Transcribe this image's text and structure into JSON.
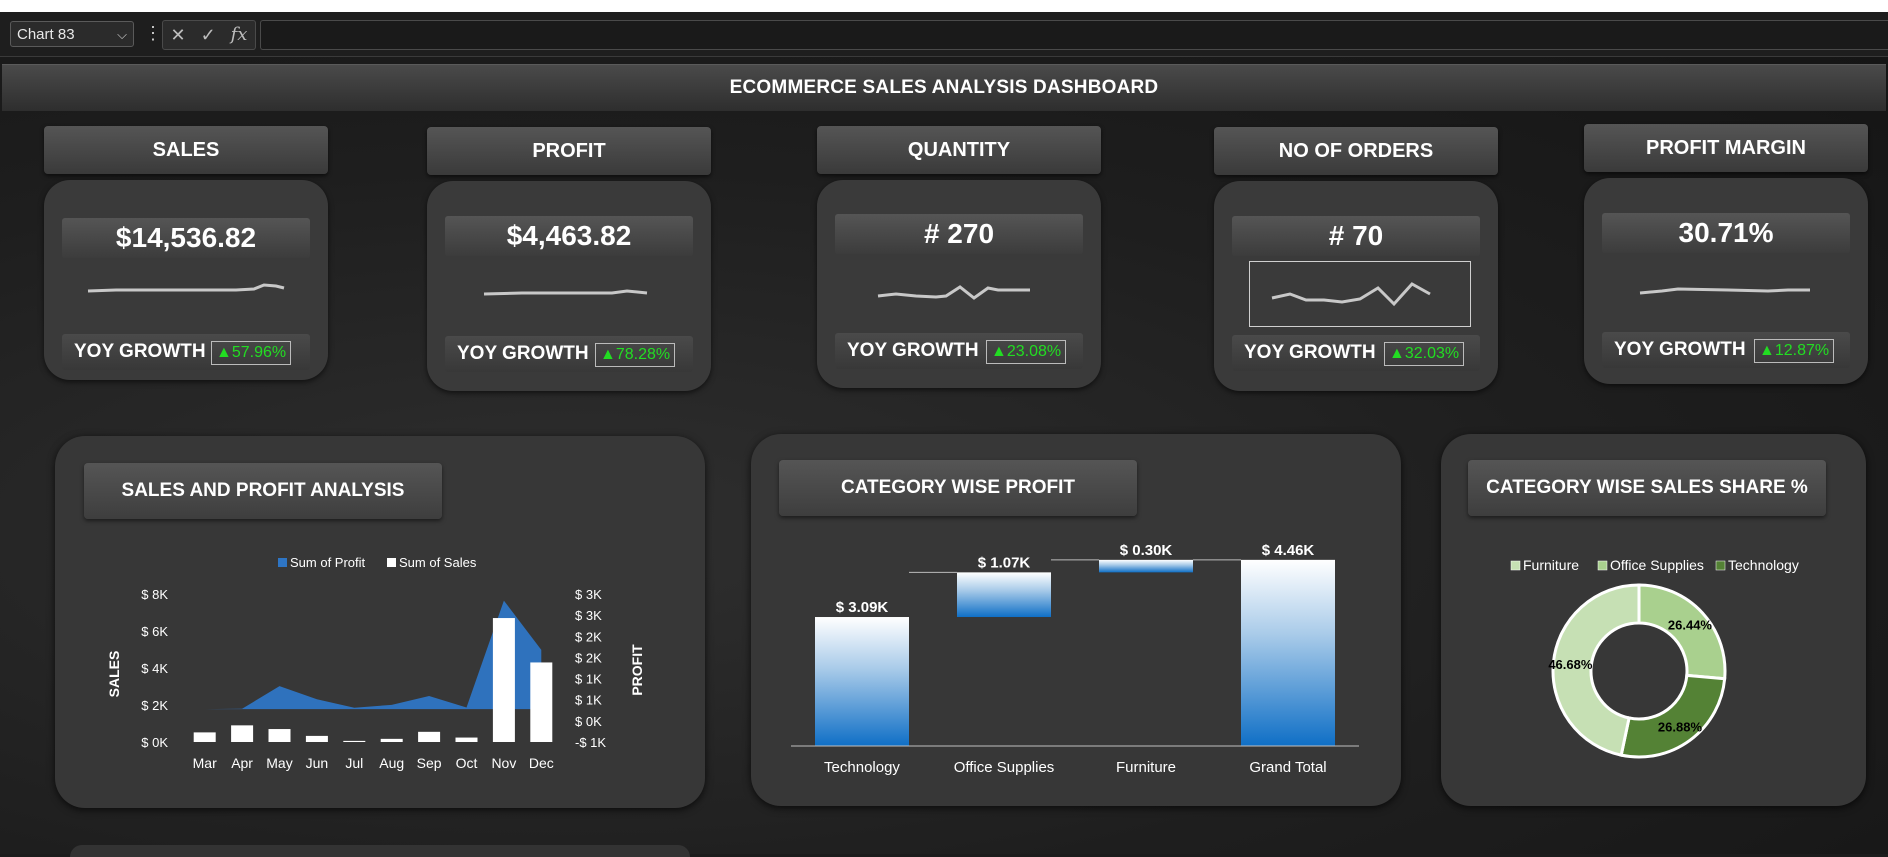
{
  "formula_bar": {
    "name_box": "Chart 83",
    "fx": "fx",
    "cancel": "✕",
    "enter": "✓"
  },
  "dashboard_title": "ECOMMERCE SALES ANALYSIS DASHBOARD",
  "growth_label": "YOY GROWTH",
  "kpis": [
    {
      "title": "SALES",
      "value": "$14,536.82",
      "yoy": "▲57.96%"
    },
    {
      "title": "PROFIT",
      "value": "$4,463.82",
      "yoy": "▲78.28%"
    },
    {
      "title": "QUANTITY",
      "value": "# 270",
      "yoy": "▲23.08%"
    },
    {
      "title": "NO OF ORDERS",
      "value": "# 70",
      "yoy": "▲32.03%"
    },
    {
      "title": "PROFIT MARGIN",
      "value": "30.71%",
      "yoy": "▲12.87%"
    }
  ],
  "colors": {
    "growth_green": "#22dd22",
    "series_profit": "#2e75c4",
    "series_sales": "#ffffff",
    "pie": [
      "#c6e0b4",
      "#a9d08e",
      "#548235"
    ]
  },
  "chart_data": [
    {
      "type": "bar",
      "title": "SALES AND PROFIT ANALYSIS",
      "categories": [
        "Mar",
        "Apr",
        "May",
        "Jun",
        "Jul",
        "Aug",
        "Sep",
        "Oct",
        "Nov",
        "Dec"
      ],
      "series": [
        {
          "name": "Sum of Sales",
          "type": "bar",
          "axis": "left",
          "values": [
            520,
            900,
            700,
            330,
            60,
            170,
            550,
            240,
            6700,
            4300
          ]
        },
        {
          "name": "Sum of Profit",
          "type": "area",
          "axis": "right",
          "values": [
            0,
            10,
            700,
            300,
            40,
            130,
            400,
            50,
            3300,
            1800
          ]
        }
      ],
      "ylabel": "SALES",
      "ylabel_right": "PROFIT",
      "yticks_left": [
        "$ 0K",
        "$ 2K",
        "$ 4K",
        "$ 6K",
        "$ 8K"
      ],
      "yticks_right": [
        "-$ 1K",
        "$ 0K",
        "$ 1K",
        "$ 1K",
        "$ 2K",
        "$ 2K",
        "$ 3K",
        "$ 3K"
      ],
      "ylim": [
        0,
        8000
      ],
      "ylim_right": [
        -1000,
        3500
      ],
      "legend": "top"
    },
    {
      "type": "bar",
      "subtype": "waterfall",
      "title": "CATEGORY WISE PROFIT",
      "categories": [
        "Technology",
        "Office Supplies",
        "Furniture",
        "Grand Total"
      ],
      "values": [
        3.09,
        1.07,
        0.3,
        4.46
      ],
      "labels": [
        "$ 3.09K",
        "$ 1.07K",
        "$ 0.30K",
        "$ 4.46K"
      ],
      "ylim": [
        0,
        4.6
      ]
    },
    {
      "type": "pie",
      "subtype": "donut",
      "title": "CATEGORY WISE SALES SHARE %",
      "categories": [
        "Furniture",
        "Office Supplies",
        "Technology"
      ],
      "values": [
        26.44,
        26.88,
        46.68
      ],
      "labels": [
        "26.44%",
        "26.88%",
        "46.68%"
      ],
      "legend": "top"
    }
  ]
}
